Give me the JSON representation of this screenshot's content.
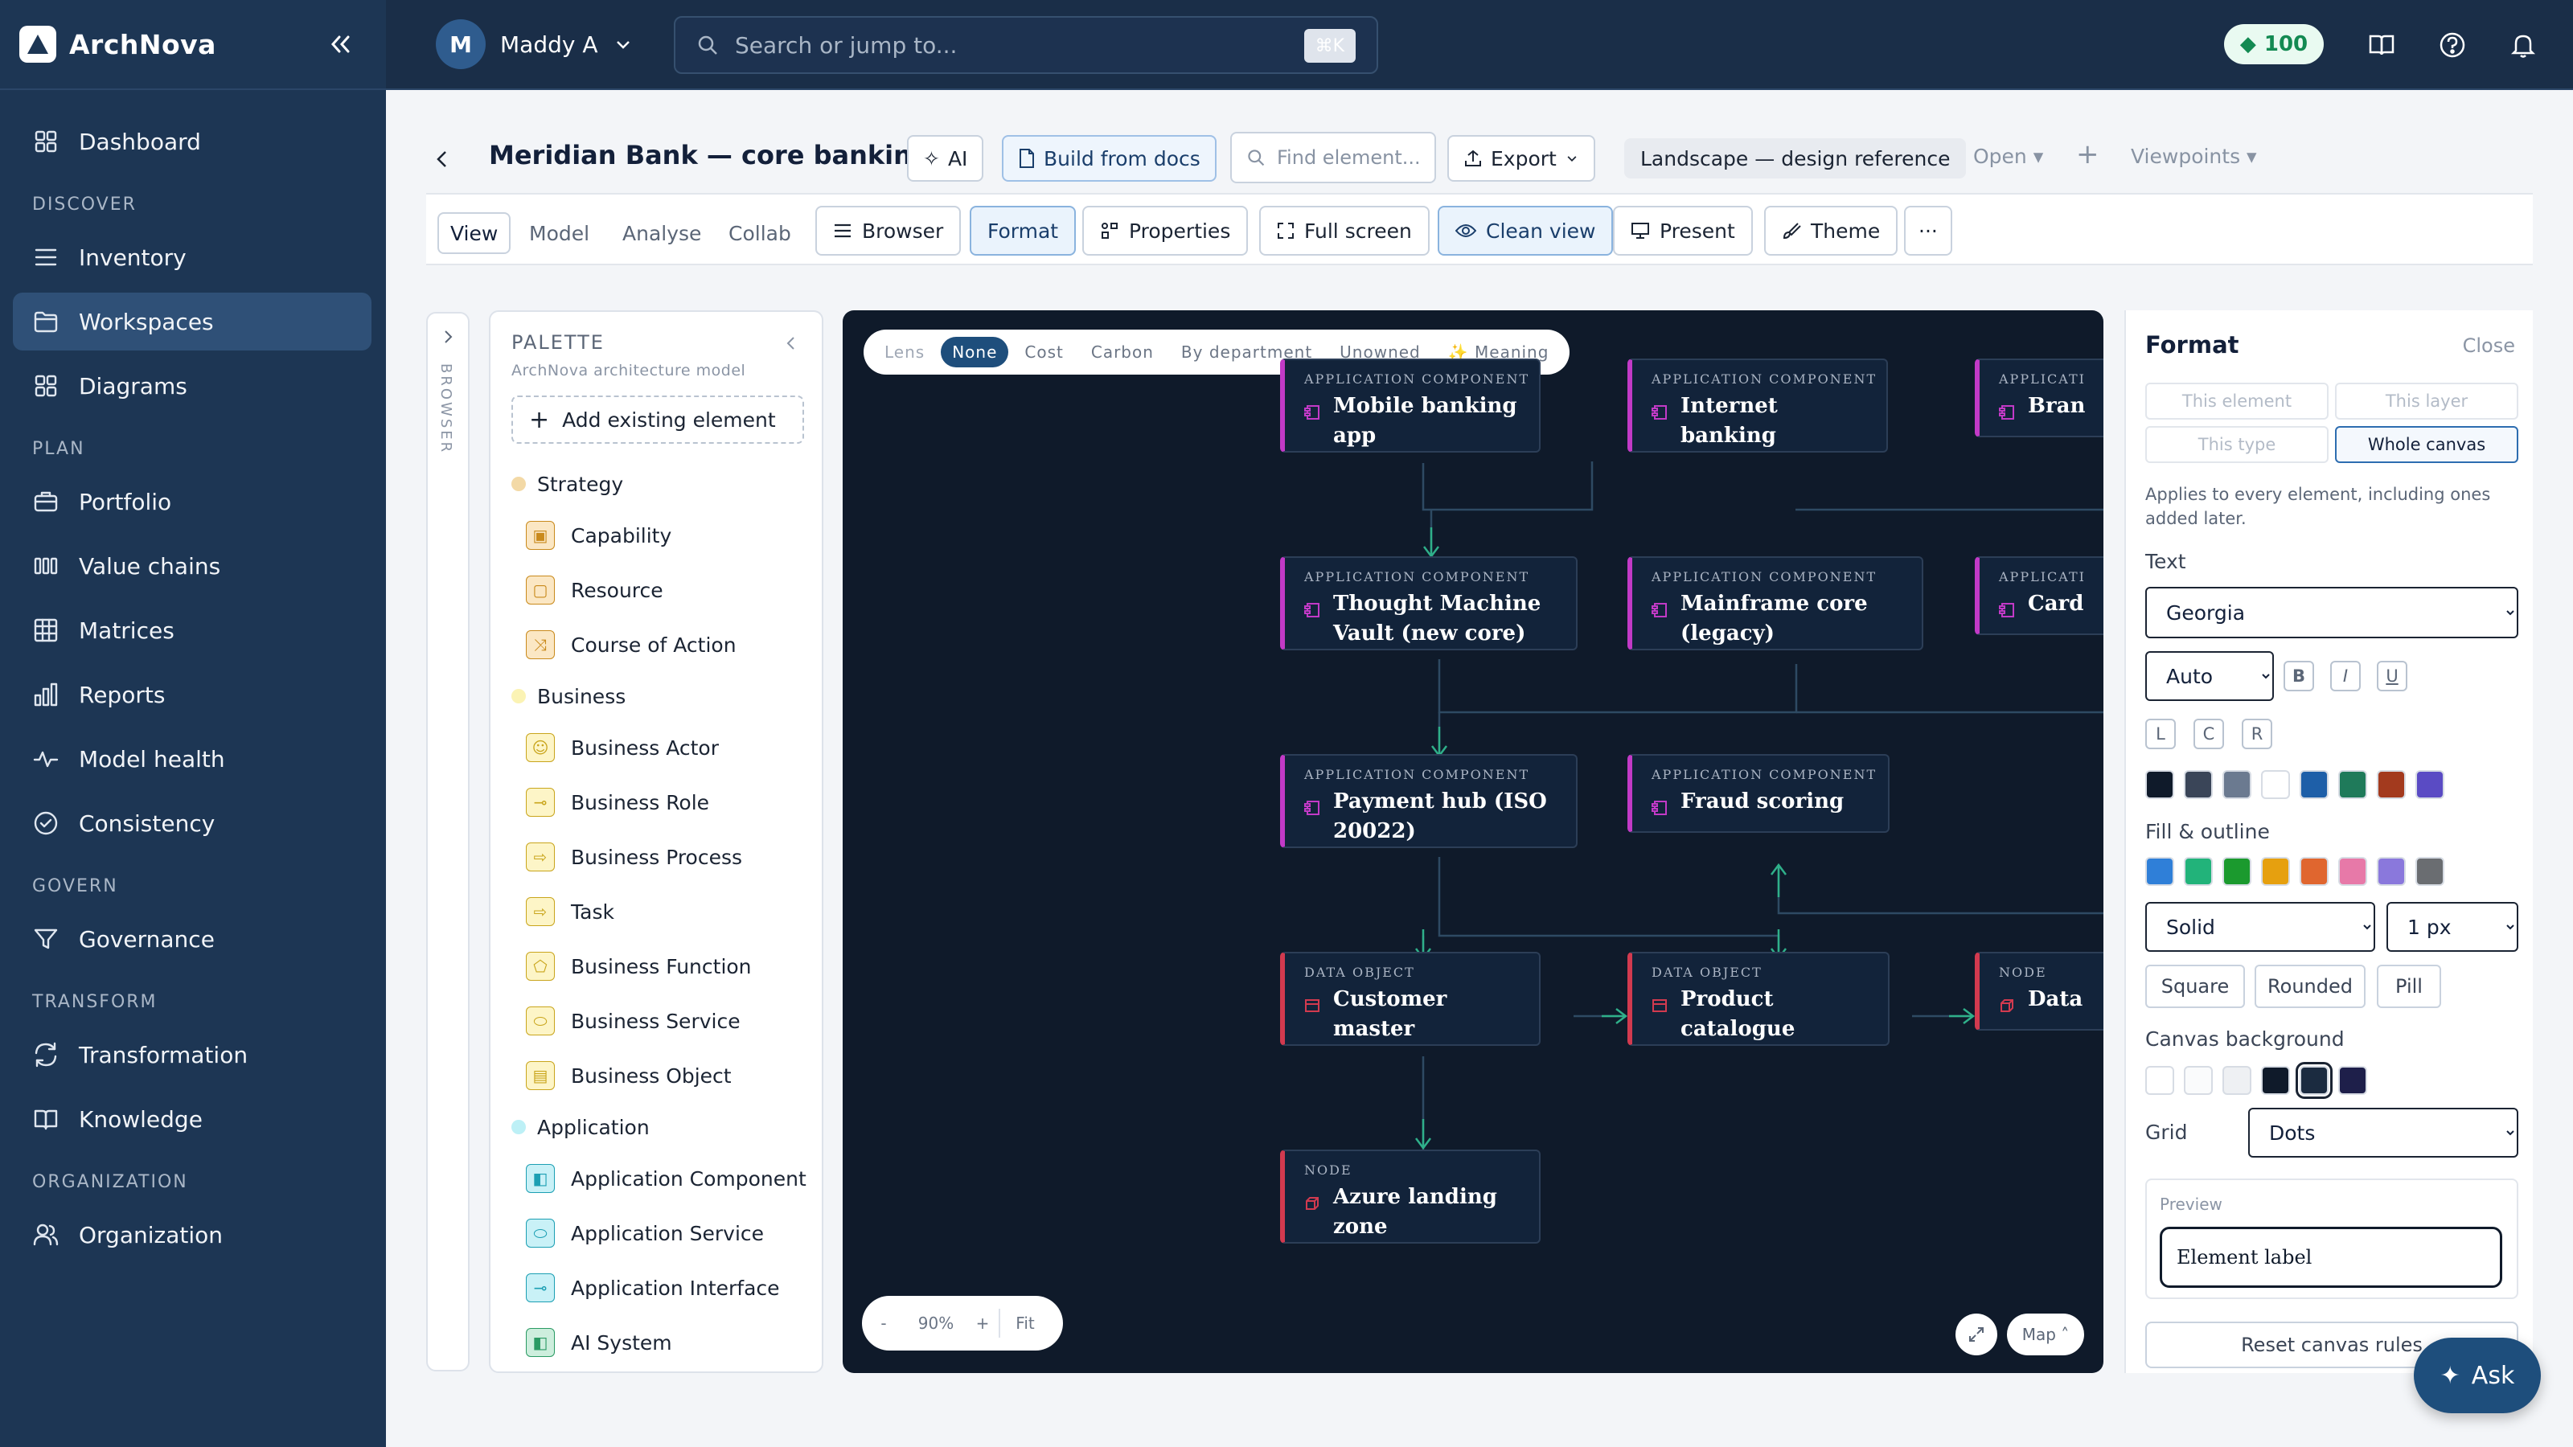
{
  "app": {
    "name": "ArchNova"
  },
  "sidebar": {
    "items": [
      {
        "type": "item",
        "name": "sidebar-item-dashboard",
        "label": "Dashboard",
        "icon": "grid-icon"
      },
      {
        "type": "section",
        "label": "DISCOVER"
      },
      {
        "type": "item",
        "name": "sidebar-item-inventory",
        "label": "Inventory",
        "icon": "list-icon"
      },
      {
        "type": "item",
        "name": "sidebar-item-workspaces",
        "label": "Workspaces",
        "icon": "folder-icon",
        "active": true
      },
      {
        "type": "item",
        "name": "sidebar-item-diagrams",
        "label": "Diagrams",
        "icon": "grid-icon"
      },
      {
        "type": "section",
        "label": "PLAN"
      },
      {
        "type": "item",
        "name": "sidebar-item-portfolio",
        "label": "Portfolio",
        "icon": "briefcase-icon"
      },
      {
        "type": "item",
        "name": "sidebar-item-value-chains",
        "label": "Value chains",
        "icon": "columns-icon"
      },
      {
        "type": "item",
        "name": "sidebar-item-matrices",
        "label": "Matrices",
        "icon": "table-icon"
      },
      {
        "type": "item",
        "name": "sidebar-item-reports",
        "label": "Reports",
        "icon": "bar-chart-icon"
      },
      {
        "type": "item",
        "name": "sidebar-item-model-health",
        "label": "Model health",
        "icon": "pulse-icon"
      },
      {
        "type": "item",
        "name": "sidebar-item-consistency",
        "label": "Consistency",
        "icon": "check-circle-icon"
      },
      {
        "type": "section",
        "label": "GOVERN"
      },
      {
        "type": "item",
        "name": "sidebar-item-governance",
        "label": "Governance",
        "icon": "filter-icon"
      },
      {
        "type": "section",
        "label": "TRANSFORM"
      },
      {
        "type": "item",
        "name": "sidebar-item-transformation",
        "label": "Transformation",
        "icon": "refresh-icon"
      },
      {
        "type": "item",
        "name": "sidebar-item-knowledge",
        "label": "Knowledge",
        "icon": "book-icon"
      },
      {
        "type": "section",
        "label": "ORGANIZATION"
      },
      {
        "type": "item",
        "name": "sidebar-item-organization",
        "label": "Organization",
        "icon": "users-icon"
      }
    ]
  },
  "topbar": {
    "user_initial": "M",
    "user_name": "Maddy A",
    "search_placeholder": "Search or jump to...",
    "search_shortcut": "⌘K",
    "credits": "100"
  },
  "project": {
    "title": "Meridian Bank — core bankin...",
    "ai_label": "AI",
    "build_label": "Build from docs",
    "find_placeholder": "Find element...",
    "export_label": "Export",
    "landscape_label": "Landscape — design reference",
    "open_label": "Open",
    "viewpoints_label": "Viewpoints"
  },
  "toolbar": {
    "tabs": [
      "View",
      "Model",
      "Analyse",
      "Collab"
    ],
    "browser": "Browser",
    "format": "Format",
    "properties": "Properties",
    "fullscreen": "Full screen",
    "cleanview": "Clean view",
    "present": "Present",
    "theme": "Theme",
    "more": "···"
  },
  "rail": {
    "label": "BROWSER"
  },
  "palette": {
    "title": "PALETTE",
    "subtitle": "ArchNova architecture model",
    "add_existing": "Add existing element",
    "groups": [
      {
        "label": "Strategy",
        "dot": "#f3d9a6",
        "items": [
          {
            "label": "Capability",
            "bg": "#fbe7c4",
            "fg": "#c98a1c"
          },
          {
            "label": "Resource",
            "bg": "#fbe7c4",
            "fg": "#c98a1c"
          },
          {
            "label": "Course of Action",
            "bg": "#fbe7c4",
            "fg": "#c98a1c"
          }
        ]
      },
      {
        "label": "Business",
        "dot": "#fbf3b4",
        "items": [
          {
            "label": "Business Actor",
            "bg": "#fdf5c7",
            "fg": "#c9a51c"
          },
          {
            "label": "Business Role",
            "bg": "#fdf5c7",
            "fg": "#c9a51c"
          },
          {
            "label": "Business Process",
            "bg": "#fdf5c7",
            "fg": "#c9a51c"
          },
          {
            "label": "Task",
            "bg": "#fdf5c7",
            "fg": "#c9a51c"
          },
          {
            "label": "Business Function",
            "bg": "#fdf5c7",
            "fg": "#c9a51c"
          },
          {
            "label": "Business Service",
            "bg": "#fdf5c7",
            "fg": "#c9a51c"
          },
          {
            "label": "Business Object",
            "bg": "#fdf5c7",
            "fg": "#c9a51c"
          }
        ]
      },
      {
        "label": "Application",
        "dot": "#bdf0f6",
        "items": [
          {
            "label": "Application Component",
            "bg": "#c9f1f7",
            "fg": "#1c9fb3"
          },
          {
            "label": "Application Service",
            "bg": "#c9f1f7",
            "fg": "#1c9fb3"
          },
          {
            "label": "Application Interface",
            "bg": "#c9f1f7",
            "fg": "#1c9fb3"
          },
          {
            "label": "AI System",
            "bg": "#cdeedd",
            "fg": "#2a9a63"
          }
        ]
      }
    ]
  },
  "canvas": {
    "lens": [
      {
        "label": "Lens",
        "dim": true
      },
      {
        "label": "None",
        "on": true
      },
      {
        "label": "Cost"
      },
      {
        "label": "Carbon"
      },
      {
        "label": "By department"
      },
      {
        "label": "Unowned"
      },
      {
        "label": "✨ Meaning"
      }
    ],
    "nodes": [
      {
        "id": "mobile",
        "kind": "APPLICATION COMPONENT",
        "title": "Mobile banking app",
        "type": "app"
      },
      {
        "id": "internet",
        "kind": "APPLICATION COMPONENT",
        "title": "Internet banking",
        "type": "app"
      },
      {
        "id": "bran",
        "kind": "APPLICATI",
        "title": "Bran",
        "type": "app"
      },
      {
        "id": "vault",
        "kind": "APPLICATION COMPONENT",
        "title": "Thought Machine Vault (new core)",
        "type": "app"
      },
      {
        "id": "mainframe",
        "kind": "APPLICATION COMPONENT",
        "title": "Mainframe core (legacy)",
        "type": "app"
      },
      {
        "id": "card",
        "kind": "APPLICATI",
        "title": "Card",
        "type": "app"
      },
      {
        "id": "payhub",
        "kind": "APPLICATION COMPONENT",
        "title": "Payment hub (ISO 20022)",
        "type": "app"
      },
      {
        "id": "fraud",
        "kind": "APPLICATION COMPONENT",
        "title": "Fraud scoring",
        "type": "app"
      },
      {
        "id": "custmaster",
        "kind": "DATA OBJECT",
        "title": "Customer master",
        "type": "data"
      },
      {
        "id": "prodcat",
        "kind": "DATA OBJECT",
        "title": "Product catalogue",
        "type": "data"
      },
      {
        "id": "datanode",
        "kind": "NODE",
        "title": "Data",
        "type": "tech"
      },
      {
        "id": "azure",
        "kind": "NODE",
        "title": "Azure landing zone",
        "type": "tech"
      }
    ],
    "zoom": {
      "minus": "-",
      "level": "90%",
      "plus": "+",
      "fit": "Fit"
    },
    "map_label": "Map ˄"
  },
  "format": {
    "title": "Format",
    "close": "Close",
    "scopes": [
      "This element",
      "This layer",
      "This type",
      "Whole canvas"
    ],
    "note": "Applies to every element, including ones added later.",
    "text_label": "Text",
    "font_value": "Georgia",
    "size_value": "Auto",
    "bold": "B",
    "italic": "I",
    "underline": "U",
    "align": [
      "L",
      "C",
      "R"
    ],
    "text_colors": [
      "#0f1a2a",
      "#3a4558",
      "#6b7a90",
      "#ffffff",
      "#1e5fa8",
      "#1f7a5a",
      "#a33a1e",
      "#5a4bc4"
    ],
    "fill_label": "Fill & outline",
    "fill_colors": [
      "#2f7fd8",
      "#22b37a",
      "#1b9a2e",
      "#e6a00f",
      "#e0662f",
      "#e779a8",
      "#8a78dc",
      "#6a6d71"
    ],
    "line_style": "Solid",
    "line_width": "1 px",
    "shapes": [
      "Square",
      "Rounded",
      "Pill"
    ],
    "bg_label": "Canvas background",
    "bg_colors": [
      "#ffffff",
      "#fafbfc",
      "#eef0f3",
      "#0f1a2a",
      "#1b2b40",
      "#1e1f4a"
    ],
    "grid_label": "Grid",
    "grid_value": "Dots",
    "preview_label": "Preview",
    "preview_text": "Element label",
    "reset": "Reset canvas rules"
  },
  "ask": {
    "label": "Ask"
  }
}
